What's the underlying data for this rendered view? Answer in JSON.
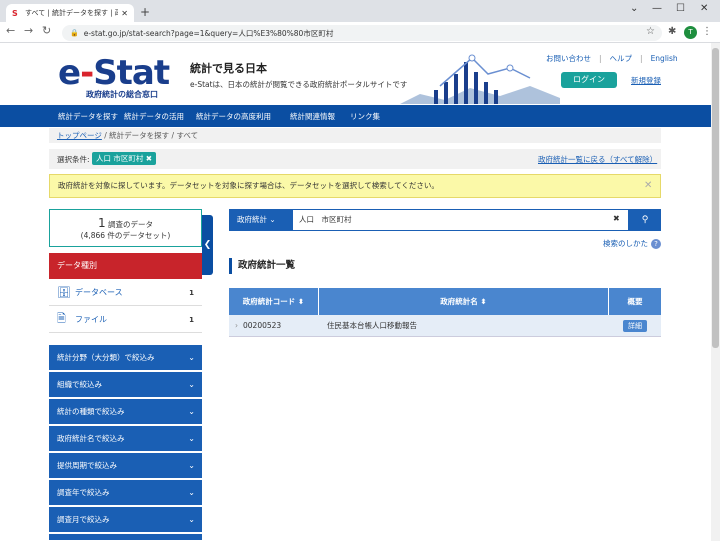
{
  "browser": {
    "tab_title": "すべて | 統計データを探す | 政府統計",
    "tab_favicon": "S",
    "url": "e-stat.go.jp/stat-search?page=1&query=人口%E3%80%80市区町村",
    "avatar_letter": "T"
  },
  "header": {
    "logo_text_a": "e",
    "logo_text_dash": "-",
    "logo_text_b": "Stat",
    "logo_sub": "政府統計の総合窓口",
    "title": "統計で見る日本",
    "subtitle": "e-Statは、日本の統計が閲覧できる政府統計ポータルサイトです",
    "links": [
      "お問い合わせ",
      "ヘルプ",
      "English"
    ],
    "login": "ログイン",
    "register": "新規登録"
  },
  "nav": [
    "統計データを探す",
    "統計データの活用",
    "統計データの高度利用",
    "統計関連情報",
    "リンク集"
  ],
  "breadcrumb": {
    "home": "トップページ",
    "items": [
      "統計データを探す",
      "すべて"
    ]
  },
  "condition": {
    "label": "選択条件:",
    "chip": "人口 市区町村",
    "reset": "政府統計一覧に戻る（すべて解除）"
  },
  "notice": "政府統計を対象に探しています。データセットを対象に探す場合は、データセットを選択して検索してください。",
  "left": {
    "count_num": "1",
    "count_label": "調査のデータ",
    "count_sub": "(4,866 件のデータセット)",
    "data_type": "データ種別",
    "types": [
      {
        "label": "データベース",
        "count": "1"
      },
      {
        "label": "ファイル",
        "count": "1"
      }
    ],
    "facets": [
      "統計分野（大分類）で絞込み",
      "組織で絞込み",
      "統計の種類で絞込み",
      "政府統計名で絞込み",
      "提供周期で絞込み",
      "調査年で絞込み",
      "調査月で絞込み"
    ]
  },
  "search": {
    "dropdown": "政府統計",
    "value": "人口　市区町村",
    "howto": "検索のしかた"
  },
  "section_title": "政府統計一覧",
  "table": {
    "headers": [
      "政府統計コード",
      "政府統計名",
      "概要"
    ],
    "rows": [
      {
        "code": "00200523",
        "name": "住民基本台帳人口移動報告",
        "action": "詳細"
      }
    ]
  },
  "colors": {
    "brand": "#0b4ea2",
    "accent": "#1aa29c",
    "alert": "#c8242b"
  }
}
